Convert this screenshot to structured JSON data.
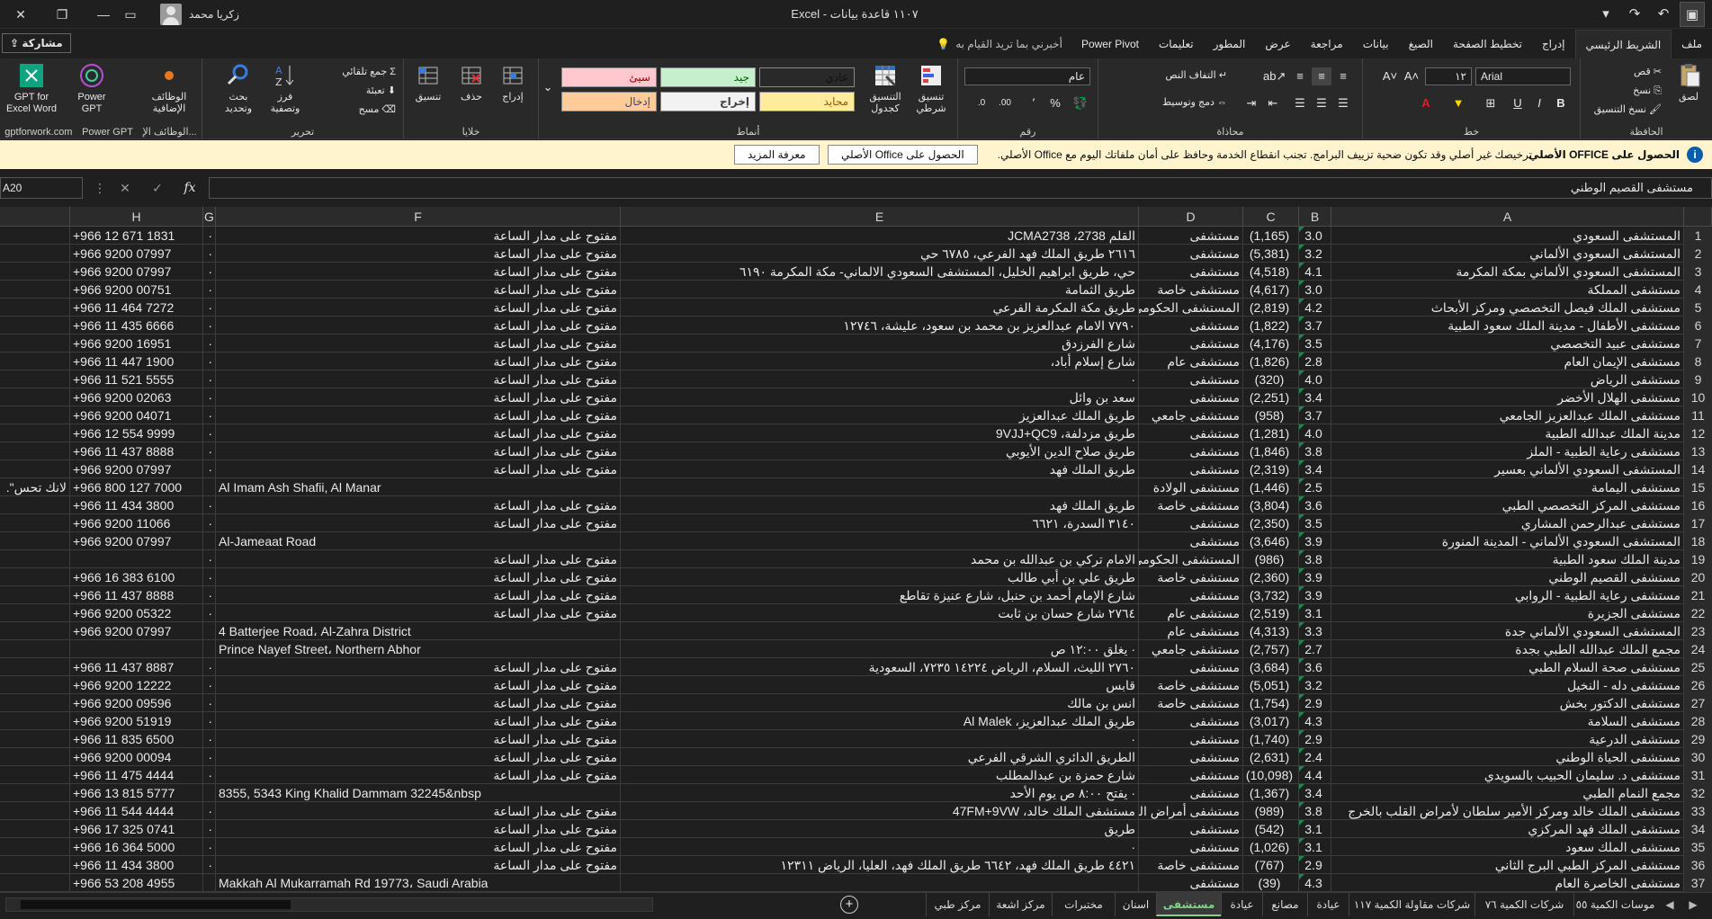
{
  "titlebar": {
    "title": "١١٠٧ قاعدة بيانات  -  Excel",
    "user_name": "زكريا محمد"
  },
  "tabs": {
    "items": [
      "ملف",
      "الشريط الرئيسي",
      "إدراج",
      "تخطيط الصفحة",
      "الصيغ",
      "بيانات",
      "مراجعة",
      "عرض",
      "المطور",
      "تعليمات",
      "Power Pivot"
    ],
    "active": "الشريط الرئيسي",
    "tell_me": "أخبرني بما تريد القيام به",
    "share": "مشاركة"
  },
  "ribbon": {
    "clipboard": {
      "label": "الحافظة",
      "paste": "لصق",
      "cut": "قص",
      "copy": "نسخ",
      "format_painter": "نسخ التنسيق"
    },
    "font": {
      "label": "خط",
      "name": "Arial",
      "size": "١٢",
      "bold": "B",
      "italic": "I",
      "underline": "U"
    },
    "alignment": {
      "label": "محاذاة",
      "wrap": "التفاف النص",
      "merge": "دمج وتوسيط"
    },
    "number": {
      "label": "رقم",
      "format": "عام",
      "percent": "%",
      "comma": "٬"
    },
    "styles": {
      "label": "أنماط",
      "conditional": "تنسيق شرطي",
      "table": "التنسيق كجدول",
      "cells": [
        {
          "text": "عادي",
          "bg": "#ffffff",
          "fg": "#000000"
        },
        {
          "text": "جيد",
          "bg": "#c6efce",
          "fg": "#006100"
        },
        {
          "text": "سيئ",
          "bg": "#ffc7ce",
          "fg": "#9c0006"
        },
        {
          "text": "محايد",
          "bg": "#ffeb9c",
          "fg": "#9c5700"
        },
        {
          "text": "إخراج",
          "bg": "#f2f2f2",
          "fg": "#3f3f3f"
        },
        {
          "text": "إدخال",
          "bg": "#ffcc99",
          "fg": "#3f3f76"
        }
      ]
    },
    "cells": {
      "label": "خلايا",
      "insert": "إدراج",
      "delete": "حذف",
      "format": "تنسيق"
    },
    "editing": {
      "label": "تحرير",
      "autosum": "جمع تلقائي",
      "fill": "تعبئة",
      "clear": "مسح",
      "sort": "فرز وتصفية",
      "find": "بحث وتحديد"
    },
    "addins": {
      "label": "الوظائف الإ...",
      "addins_btn": "الوظائف الإضافية",
      "powergpt": "Power GPT",
      "gptexcel": "GPT for Excel Word",
      "gptforwork_label": "gptforwork.com",
      "powergpt_label": "Power GPT"
    }
  },
  "message_bar": {
    "title": "الحصول على OFFICE الأصلي",
    "text": "ترخيصك غير أصلي وقد تكون ضحية تزييف البرامج. تجنب انقطاع الخدمة وحافظ على أمان ملفاتك اليوم مع Office الأصلي.",
    "btn_get": "الحصول على Office الأصلي",
    "btn_learn": "معرفة المزيد"
  },
  "formula_bar": {
    "name_box": "A20",
    "content": "مستشفى القصيم الوطني"
  },
  "columns": [
    "A",
    "B",
    "C",
    "D",
    "E",
    "F",
    "G",
    "H"
  ],
  "rows": [
    {
      "n": "1",
      "a": "المستشفى السعودي",
      "b": "3.0",
      "c": "(1,165)",
      "d": "مستشفى",
      "e": "القلم 2738، JCMA2738",
      "e_ltr": true,
      "f": "مفتوح على مدار الساعة",
      "g": "·",
      "h": "+966 12 671 1831"
    },
    {
      "n": "2",
      "a": "المستشفى السعودي الألماني",
      "b": "3.2",
      "c": "(5,381)",
      "d": "مستشفى",
      "e": "٢٦١٦ طريق الملك فهد الفرعي، ٦٧٨٥ حي",
      "f": "مفتوح على مدار الساعة",
      "g": "·",
      "h": "+966 9200 07997"
    },
    {
      "n": "3",
      "a": "المستشفى السعودي الألماني بمكة المكرمة",
      "b": "4.1",
      "c": "(4,518)",
      "d": "مستشفى",
      "e": "حي، طريق ابراهيم الخليل، المستشفى السعودي الالماني- مكة المكرمة ٦١٩٠",
      "f": "مفتوح على مدار الساعة",
      "g": "·",
      "h": "+966 9200 07997"
    },
    {
      "n": "4",
      "a": "مستشفى المملكة",
      "b": "3.0",
      "c": "(4,617)",
      "d": "مستشفى خاصة",
      "e": "طريق الثمامة",
      "f": "مفتوح على مدار الساعة",
      "g": "·",
      "h": "+966 9200 00751"
    },
    {
      "n": "5",
      "a": "مستشفى الملك فيصل التخصصي ومركز الأبحاث",
      "b": "4.2",
      "c": "(2,819)",
      "d": "المستشفى الحكومي",
      "e": "طريق مكة المكرمة الفرعي",
      "f": "مفتوح على مدار الساعة",
      "g": "·",
      "h": "+966 11 464 7272"
    },
    {
      "n": "6",
      "a": "مستشفى الأطفال - مدينة الملك سعود الطبية",
      "b": "3.7",
      "c": "(1,822)",
      "d": "مستشفى",
      "e": "٧٧٩٠ الامام عبدالعزيز بن محمد بن سعود، عليشة، ١٢٧٤٦",
      "f": "مفتوح على مدار الساعة",
      "g": "·",
      "h": "+966 11 435 6666"
    },
    {
      "n": "7",
      "a": "مستشفى عبيد التخصصي",
      "b": "3.5",
      "c": "(4,176)",
      "d": "مستشفى",
      "e": "شارع الفرزدق",
      "f": "مفتوح على مدار الساعة",
      "g": "·",
      "h": "+966 9200 16951"
    },
    {
      "n": "8",
      "a": "مستشفى الإيمان العام",
      "b": "2.8",
      "c": "(1,826)",
      "d": "مستشفى عام",
      "e": "شارع إسلام أباد،",
      "f": "مفتوح على مدار الساعة",
      "g": "·",
      "h": "+966 11 447 1900"
    },
    {
      "n": "9",
      "a": "مستشفى الرياض",
      "b": "4.0",
      "c": "(320)",
      "d": "مستشفى",
      "e": "·",
      "f": "مفتوح على مدار الساعة",
      "g": "·",
      "h": "+966 11 521 5555"
    },
    {
      "n": "10",
      "a": "مستشفى الهلال الأخضر",
      "b": "3.4",
      "c": "(2,251)",
      "d": "مستشفى",
      "e": "سعد بن وائل",
      "f": "مفتوح على مدار الساعة",
      "g": "·",
      "h": "+966 9200 02063"
    },
    {
      "n": "11",
      "a": "مستشفى الملك عبدالعزيز الجامعي",
      "b": "3.7",
      "c": "(958)",
      "d": "مستشفى جامعي",
      "e": "طريق الملك عبدالعزيز",
      "f": "مفتوح على مدار الساعة",
      "g": "·",
      "h": "+966 9200 04071"
    },
    {
      "n": "12",
      "a": "مدينة الملك عبدالله الطبية",
      "b": "4.0",
      "c": "(1,281)",
      "d": "مستشفى",
      "e": "طريق مزدلفة، 9VJJ+QC9",
      "e_ltr": true,
      "f": "مفتوح على مدار الساعة",
      "g": "·",
      "h": "+966 12 554 9999"
    },
    {
      "n": "13",
      "a": "مستشفى رعاية الطبية - الملز",
      "b": "3.8",
      "c": "(1,846)",
      "d": "مستشفى",
      "e": "طريق صلاح الدين الأيوبي",
      "f": "مفتوح على مدار الساعة",
      "g": "·",
      "h": "+966 11 437 8888"
    },
    {
      "n": "14",
      "a": "المستشفى السعودي الألماني بعسير",
      "b": "3.4",
      "c": "(2,319)",
      "d": "مستشفى",
      "e": "طريق الملك فهد",
      "f": "مفتوح على مدار الساعة",
      "g": "·",
      "h": "+966 9200 07997"
    },
    {
      "n": "15",
      "a": "مستشفى اليمامة",
      "b": "2.5",
      "c": "(1,446)",
      "d": "مستشفى الولادة",
      "e": "",
      "f": "Al Imam Ash Shafii, Al Manar",
      "f_ltr": true,
      "g": "",
      "h": "+966 800 127 7000",
      "tail": "لانك تحس\"."
    },
    {
      "n": "16",
      "a": "مستشفى المركز التخصصي الطبي",
      "b": "3.6",
      "c": "(3,804)",
      "d": "مستشفى خاصة",
      "e": "طريق الملك فهد",
      "f": "مفتوح على مدار الساعة",
      "g": "·",
      "h": "+966 11 434 3800"
    },
    {
      "n": "17",
      "a": "مستشفى عبدالرحمن المشاري",
      "b": "3.5",
      "c": "(2,350)",
      "d": "مستشفى",
      "e": "٣١٤٠ السدرة، ٦٦٢١",
      "f": "مفتوح على مدار الساعة",
      "g": "·",
      "h": "+966 9200 11066"
    },
    {
      "n": "18",
      "a": "المستشفى السعودي الألماني - المدينة المنورة",
      "b": "3.9",
      "c": "(3,646)",
      "d": "مستشفى",
      "e": "",
      "f": "Al-Jameaat Road",
      "f_ltr": true,
      "g": "",
      "h": "+966 9200 07997"
    },
    {
      "n": "19",
      "a": "مدينة الملك سعود الطبية",
      "b": "3.8",
      "c": "(986)",
      "d": "المستشفى الحكومي",
      "e": "الامام تركي بن عبدالله بن محمد",
      "f": "مفتوح على مدار الساعة",
      "g": "·",
      "h": ""
    },
    {
      "n": "20",
      "a": "مستشفى القصيم الوطني",
      "b": "3.9",
      "c": "(2,360)",
      "d": "مستشفى خاصة",
      "e": "طريق علي بن أبي طالب",
      "f": "مفتوح على مدار الساعة",
      "g": "·",
      "h": "+966 16 383 6100"
    },
    {
      "n": "21",
      "a": "مستشفى رعاية الطبية - الروابي",
      "b": "3.9",
      "c": "(3,732)",
      "d": "مستشفى",
      "e": "شارع الإمام أحمد بن حنبل، شارع عنيزة تقاطع",
      "f": "مفتوح على مدار الساعة",
      "g": "·",
      "h": "+966 11 437 8888"
    },
    {
      "n": "22",
      "a": "مستشفى الجزيرة",
      "b": "3.1",
      "c": "(2,519)",
      "d": "مستشفى عام",
      "e": "٢٧٦٤ شارع حسان بن ثابت",
      "f": "مفتوح على مدار الساعة",
      "g": "·",
      "h": "+966 9200 05322"
    },
    {
      "n": "23",
      "a": "المستشفى السعودي الألماني جدة",
      "b": "3.3",
      "c": "(4,313)",
      "d": "مستشفى عام",
      "e": "",
      "f": "4 Batterjee Road، Al-Zahra District",
      "f_ltr": true,
      "g": "",
      "h": "+966 9200 07997"
    },
    {
      "n": "24",
      "a": "مجمع الملك عبدالله الطبي بجدة",
      "b": "2.7",
      "c": "(2,757)",
      "d": "مستشفى جامعي",
      "e": "· يغلق ١٢:٠٠ ص",
      "f": "Prince Nayef Street، Northern Abhor",
      "f_ltr": true,
      "g": "",
      "h": ""
    },
    {
      "n": "25",
      "a": "مستشفى صحة السلام الطبي",
      "b": "3.6",
      "c": "(3,684)",
      "d": "مستشفى",
      "e": "٢٧٦٠ الليث، السلام، الرياض ١٤٢٢٤ ٧٢٣٥، السعودية",
      "f": "مفتوح على مدار الساعة",
      "g": "·",
      "h": "+966 11 437 8887"
    },
    {
      "n": "26",
      "a": "مستشفى دله - النخيل",
      "b": "3.2",
      "c": "(5,051)",
      "d": "مستشفى خاصة",
      "e": "قابس",
      "f": "مفتوح على مدار الساعة",
      "g": "·",
      "h": "+966 9200 12222"
    },
    {
      "n": "27",
      "a": "مستشفى الدكتور بخش",
      "b": "2.9",
      "c": "(1,754)",
      "d": "مستشفى خاصة",
      "e": "انس بن مالك",
      "f": "مفتوح على مدار الساعة",
      "g": "·",
      "h": "+966 9200 09596"
    },
    {
      "n": "28",
      "a": "مستشفى السلامة",
      "b": "4.3",
      "c": "(3,017)",
      "d": "مستشفى",
      "e": "طريق الملك عبدالعزيز، Al Malek",
      "f": "مفتوح على مدار الساعة",
      "g": "·",
      "h": "+966 9200 51919"
    },
    {
      "n": "29",
      "a": "مستشفى الدرعية",
      "b": "2.9",
      "c": "(1,740)",
      "d": "مستشفى",
      "e": "·",
      "f": "مفتوح على مدار الساعة",
      "g": "·",
      "h": "+966 11 835 6500"
    },
    {
      "n": "30",
      "a": "مستشفى الحياة الوطني",
      "b": "2.4",
      "c": "(2,631)",
      "d": "مستشفى",
      "e": "الطريق الدائري الشرقي الفرعي",
      "f": "مفتوح على مدار الساعة",
      "g": "·",
      "h": "+966 9200 00094"
    },
    {
      "n": "31",
      "a": "مستشفى د. سليمان الحبيب بالسويدي",
      "b": "4.4",
      "c": "(10,098)",
      "d": "مستشفى",
      "e": "شارع حمزة بن عبدالمطلب",
      "f": "مفتوح على مدار الساعة",
      "g": "·",
      "h": "+966 11 475 4444"
    },
    {
      "n": "32",
      "a": "مجمع النمام الطبي",
      "b": "3.4",
      "c": "(1,367)",
      "d": "مستشفى",
      "e": "· يفتح ٨:٠٠ ص يوم الأحد",
      "f": "8355, 5343 King Khalid Dammam 32245&nbsp",
      "f_ltr": true,
      "g": "",
      "h": "+966 13 815 5777"
    },
    {
      "n": "33",
      "a": "مستشفى الملك خالد ومركز الأمير سلطان لأمراض القلب بالخرج",
      "b": "3.8",
      "c": "(989)",
      "d": "مستشفى أمراض القلب",
      "e": "مستشفى الملك خالد، 47FM+9VW",
      "e_ltr": true,
      "f": "مفتوح على مدار الساعة",
      "g": "·",
      "h": "+966 11 544 4444"
    },
    {
      "n": "34",
      "a": "مستشفى الملك فهد المركزي",
      "b": "3.1",
      "c": "(542)",
      "d": "مستشفى",
      "e": "طريق",
      "f": "مفتوح على مدار الساعة",
      "g": "·",
      "h": "+966 17 325 0741"
    },
    {
      "n": "35",
      "a": "مستشفى الملك سعود",
      "b": "3.1",
      "c": "(1,026)",
      "d": "مستشفى",
      "e": "·",
      "f": "مفتوح على مدار الساعة",
      "g": "·",
      "h": "+966 16 364 5000"
    },
    {
      "n": "36",
      "a": "مستشفى المركز الطبي البرج الثاني",
      "b": "2.9",
      "c": "(767)",
      "d": "مستشفى خاصة",
      "e": "٤٤٢١ طريق الملك فهد، ٦٦٤٢ طريق الملك فهد، العليا، الرياض ١٢٣١١",
      "f": "مفتوح على مدار الساعة",
      "g": "·",
      "h": "+966 11 434 3800"
    },
    {
      "n": "37",
      "a": "مستشفى الخاصرة العام",
      "b": "4.3",
      "c": "(39)",
      "d": "مستشفى",
      "e": "",
      "f": "Makkah Al Mukarramah Rd 19773، Saudi Arabia",
      "f_ltr": true,
      "g": "",
      "h": "+966 53 208 4955"
    }
  ],
  "sheets": [
    {
      "name": "موسات الكمية ٥٥",
      "active": false
    },
    {
      "name": "شركات الكمية ٧٦",
      "active": false
    },
    {
      "name": "شركات مقاولة الكمية ١١٧",
      "active": false
    },
    {
      "name": "عيادة",
      "active": false
    },
    {
      "name": "مصانع",
      "active": false
    },
    {
      "name": "عيادة",
      "active": false
    },
    {
      "name": "مستشفى",
      "active": true
    },
    {
      "name": "اسنان",
      "active": false
    },
    {
      "name": "مختبرات",
      "active": false
    },
    {
      "name": "مركز اشعة",
      "active": false
    },
    {
      "name": "مركز طبي",
      "active": false
    }
  ],
  "colors": {
    "accent_green": "#1e8449",
    "msgbar": "#fff4ce",
    "active_sheet": "#7fd58a"
  }
}
